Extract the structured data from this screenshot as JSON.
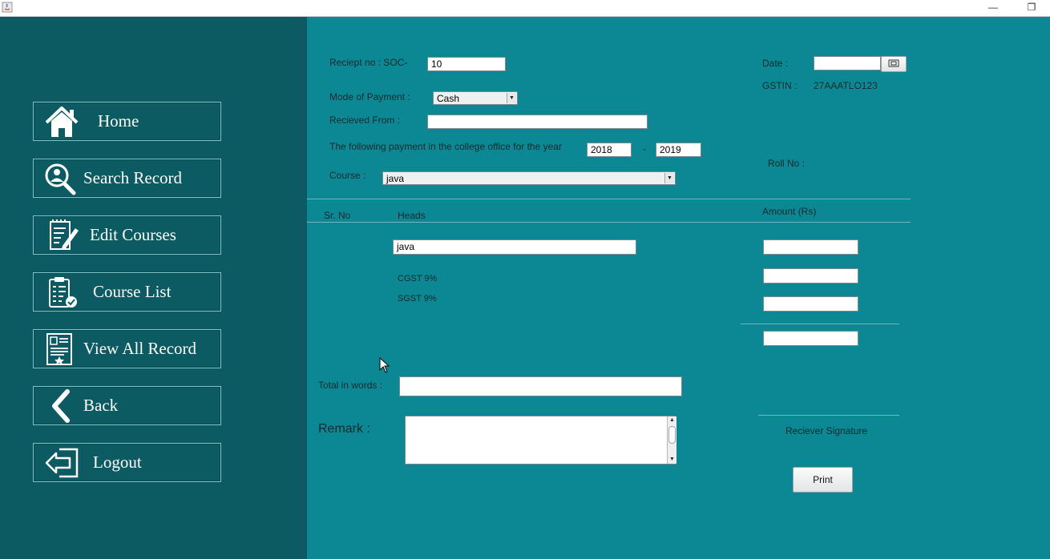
{
  "window": {
    "minimize_glyph": "—",
    "restore_glyph": "❐"
  },
  "nav": {
    "items": [
      {
        "label": "Home",
        "icon": "home-icon"
      },
      {
        "label": "Search Record",
        "icon": "user-search-icon"
      },
      {
        "label": "Edit Courses",
        "icon": "edit-document-icon"
      },
      {
        "label": "Course List",
        "icon": "clipboard-check-icon"
      },
      {
        "label": "View All Record",
        "icon": "certificate-icon"
      },
      {
        "label": "Back",
        "icon": "chevron-left-icon"
      },
      {
        "label": "Logout",
        "icon": "logout-icon"
      }
    ]
  },
  "form": {
    "receipt_label": "Reciept no :  SOC-",
    "receipt_value": "10",
    "date_label": "Date :",
    "date_value": "",
    "gstin_label": "GSTIN :",
    "gstin_value": "27AAATLO123",
    "mode_label": "Mode of Payment :",
    "mode_value": "Cash",
    "received_from_label": "Recieved From :",
    "received_from_value": "",
    "year_label": "The following payment in the college office for the year",
    "year_from": "2018",
    "year_sep": "-",
    "year_to": "2019",
    "course_label": "Course :",
    "course_value": "java",
    "roll_label": "Roll No :"
  },
  "table": {
    "col_srno": "Sr. No",
    "col_heads": "Heads",
    "col_amount": "Amount (Rs)",
    "head_value": "java",
    "cgst_label": "CGST 9%",
    "sgst_label": "SGST 9%"
  },
  "footer": {
    "total_words_label": "Total in words :",
    "total_words_value": "",
    "remark_label": "Remark :",
    "remark_value": "",
    "signature_label": "Reciever Signature",
    "print_label": "Print"
  }
}
